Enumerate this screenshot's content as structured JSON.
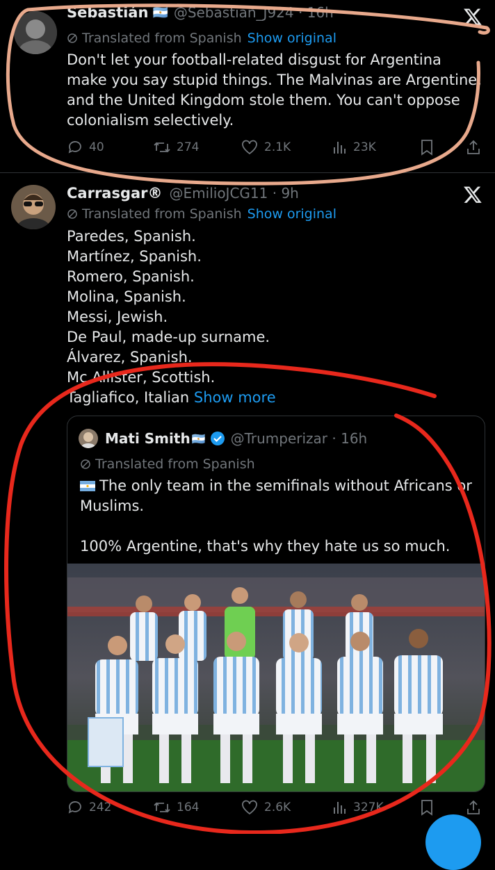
{
  "tweet1": {
    "name": "Sebastián",
    "name_flags": "🇦🇷",
    "handle": "@Sebastian_J924 · 16h",
    "translated_label": "Translated from Spanish",
    "show_original_label": "Show original",
    "text": "Don't let your football-related disgust for Argentina make you say stupid things. The Malvinas are Argentine, and the United Kingdom stole them. You can't oppose colonialism selectively.",
    "replies": "40",
    "reposts": "274",
    "likes": "2.1K",
    "views": "23K"
  },
  "tweet2": {
    "name": "Carrasgar®",
    "handle": "@EmilioJCG11 · 9h",
    "translated_label": "Translated from Spanish",
    "show_original_label": "Show original",
    "lines": [
      "Paredes, Spanish.",
      "Martínez, Spanish.",
      "Romero, Spanish.",
      "Molina, Spanish.",
      "Messi, Jewish.",
      "De Paul, made-up surname.",
      "Álvarez, Spanish.",
      "Mc Allister, Scottish."
    ],
    "last_line": "Tagliafico, Italian",
    "show_more_label": "Show more",
    "replies": "242",
    "reposts": "164",
    "likes": "2.6K",
    "views": "327K"
  },
  "quote": {
    "name": "Mati Smith",
    "flag": "🇦🇷",
    "handle": "@Trumperizar · 16h",
    "translated_label": "Translated from Spanish",
    "text_line1": "The only team in the semifinals without Africans or Muslims.",
    "text_line2": "100% Argentine, that's why they hate us so much."
  },
  "colors": {
    "background": "#000000",
    "accent": "#1d9bf0",
    "muted": "#71767b",
    "annotation_orange": "#e8a98c",
    "annotation_red": "#e8281c"
  }
}
